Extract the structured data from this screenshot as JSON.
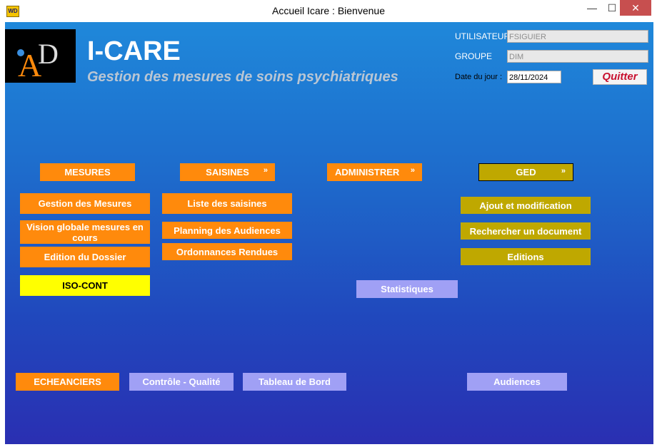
{
  "window": {
    "title": "Accueil Icare : Bienvenue",
    "icon": "windev-icon",
    "icon_text": "WD",
    "controls": {
      "minimize": "—",
      "maximize": "☐",
      "close": "✕"
    }
  },
  "header": {
    "logo_text": "AD",
    "app_name": "I-CARE",
    "subtitle": "Gestion des mesures de soins psychiatriques"
  },
  "user_panel": {
    "user_label": "UTILISATEUR",
    "user_value": "FSIGUIER",
    "group_label": "GROUPE",
    "group_value": "DIM",
    "date_label": "Date du jour :",
    "date_value": "28/11/2024",
    "quit_label": "Quitter"
  },
  "menus": {
    "mesures": {
      "header": "MESURES",
      "items": [
        "Gestion des Mesures",
        "Vision globale mesures en cours",
        "Edition du Dossier",
        "ISO-CONT"
      ]
    },
    "saisines": {
      "header": "SAISINES",
      "chevron": "double-chevron-down-icon",
      "items": [
        "Liste des saisines",
        "Planning des Audiences",
        "Ordonnances Rendues"
      ]
    },
    "administrer": {
      "header": "ADMINISTRER",
      "chevron": "double-chevron-down-icon",
      "items": [
        "Statistiques"
      ]
    },
    "ged": {
      "header": "GED",
      "chevron": "double-chevron-down-icon",
      "items": [
        "Ajout et modification",
        "Rechercher un document",
        "Editions"
      ]
    }
  },
  "bottom_buttons": [
    "ECHEANCIERS",
    "Contrôle - Qualité",
    "Tableau de Bord",
    "Audiences"
  ],
  "colors": {
    "orange": "#ff8a0c",
    "olive": "#bfa800",
    "lilac": "#a0a0f5",
    "yellow": "#ffff00",
    "background_top": "#1f88da",
    "background_bottom": "#2a2fb2"
  }
}
